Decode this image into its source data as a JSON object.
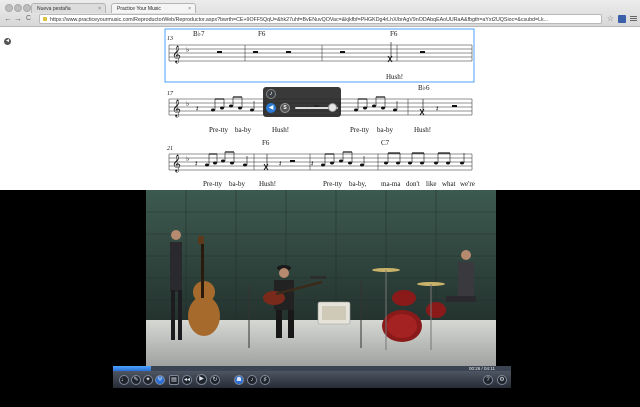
{
  "browser": {
    "tabs": [
      {
        "label": "Nueva pestaña",
        "close": "×"
      },
      {
        "label": "Practice Your Music",
        "close": "×"
      }
    ],
    "nav": {
      "back": "←",
      "forward": "→",
      "reload": "C"
    },
    "url": "https://www.practiceyourmusic.com/ReproductorWeb/Reproductor.aspx?bwrth=CE+9OFF5QqU=&hk27uhf=BvENuvQOVac=&kjkfbf=PHGKDg4rLhX/brAgV9nODAbqEAoUURaA&fbgth=aYxt2UQSioc=&csubd=Lk..."
  },
  "score": {
    "systems": [
      {
        "measure_number": "13",
        "chords": [
          "B♭7",
          "F6",
          "F6"
        ],
        "lyrics": [
          "Hush!"
        ]
      },
      {
        "measure_number": "17",
        "chords": [
          "B♭6"
        ],
        "lyrics": [
          "Pre-tty",
          "ba-by",
          "Hush!",
          "Pre-tty",
          "ba-by",
          "Hush!"
        ]
      },
      {
        "measure_number": "21",
        "chords": [
          "F6",
          "C7"
        ],
        "lyrics": [
          "Pre-tty",
          "ba-by",
          "Hush!",
          "Pre-tty",
          "ba-by,",
          "ma-ma",
          "don't",
          "like",
          "what",
          "we're"
        ]
      }
    ]
  },
  "mixer": {
    "top_icon": "speaker-icon",
    "left_icon": "volume-icon",
    "solo_label": "S",
    "volume": 0.88
  },
  "player": {
    "progress": 0.095,
    "time_text": "00:26 / 04:11",
    "buttons": [
      "metronome-icon",
      "pencil-icon",
      "brush-icon",
      "tuner-icon",
      "film-icon",
      "rewind-icon",
      "play-icon",
      "loop-icon",
      "band-icon",
      "tempo-icon",
      "pitch-icon",
      "help-icon",
      "settings-icon"
    ]
  },
  "colors": {
    "selection": "#4aa3ff",
    "player_bar": "#3b4452",
    "progress": "#2b6fd6"
  }
}
